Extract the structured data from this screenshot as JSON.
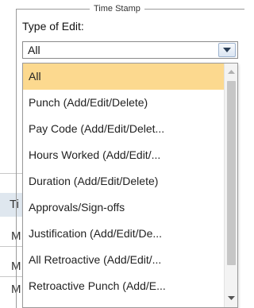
{
  "group": {
    "legend": "Time Stamp"
  },
  "field": {
    "label": "Type of Edit:",
    "selected_value": "All"
  },
  "dropdown": {
    "options": [
      "All",
      "Punch (Add/Edit/Delete)",
      "Pay Code (Add/Edit/Delet...",
      "Hours Worked (Add/Edit/...",
      "Duration (Add/Edit/Delete)",
      "Approvals/Sign-offs",
      "Justification (Add/Edit/De...",
      "All Retroactive (Add/Edit/...",
      "Retroactive Punch (Add/E..."
    ],
    "highlighted_index": 0
  },
  "background": {
    "chars": [
      "Ti",
      "M",
      "M",
      "M"
    ]
  },
  "colors": {
    "highlight": "#fcd98f",
    "scroll_thumb": "#c6c6c6",
    "dropdown_button": "#dbe6f3"
  },
  "icons": {
    "select_arrow": "chevron-down-icon",
    "scroll_up": "triangle-up-icon",
    "scroll_down": "triangle-down-icon"
  }
}
